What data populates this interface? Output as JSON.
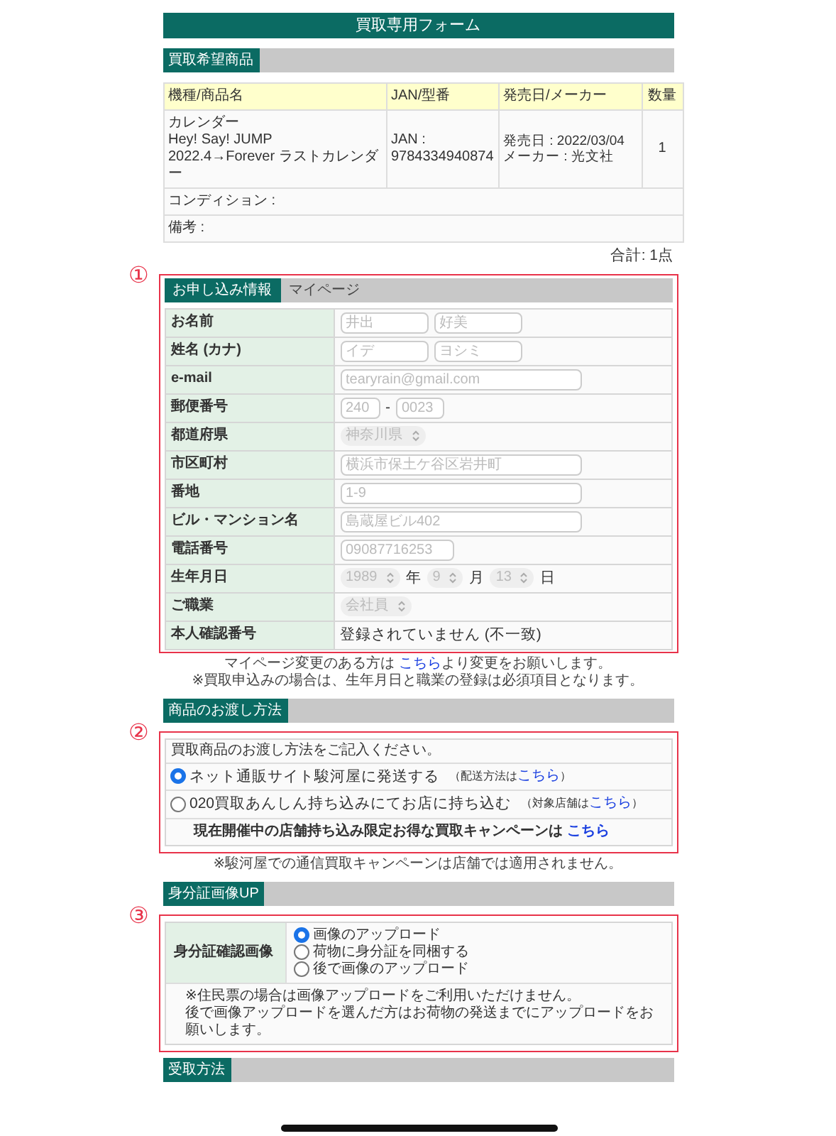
{
  "form_title": "買取専用フォーム",
  "items": {
    "heading": "買取希望商品",
    "columns": [
      "機種/商品名",
      "JAN/型番",
      "発売日/メーカー",
      "数量"
    ],
    "rows": [
      {
        "cells": [
          [
            "カレンダー",
            "Hey! Say! JUMP 2022.4→Forever ラストカレンダー"
          ],
          [
            "JAN : 9784334940874"
          ],
          [
            "発売日 : 2022/03/04",
            "メーカー : 光文社"
          ],
          [
            "1"
          ]
        ]
      }
    ],
    "extra_rows": [
      "コンディション :",
      "備考 :"
    ],
    "total": "合計: 1点"
  },
  "applicant": {
    "annotation": "①",
    "tabs": [
      {
        "label": "お申し込み情報",
        "selected": true
      },
      {
        "label": "マイページ",
        "selected": false
      }
    ],
    "rows": [
      {
        "label": "お名前",
        "parts": [
          {
            "kind": "input",
            "placeholder": "井出"
          },
          {
            "kind": "input",
            "placeholder": "好美"
          }
        ]
      },
      {
        "label": "姓名 (カナ)",
        "parts": [
          {
            "kind": "input",
            "placeholder": "イデ"
          },
          {
            "kind": "input",
            "placeholder": "ヨシミ"
          }
        ]
      },
      {
        "label": "e-mail",
        "parts": [
          {
            "kind": "input",
            "placeholder": "tearyrain@gmail.com"
          }
        ]
      },
      {
        "label": "郵便番号",
        "parts": [
          {
            "kind": "input",
            "placeholder": "240"
          },
          {
            "kind": "text",
            "text": "-"
          },
          {
            "kind": "input",
            "placeholder": "0023"
          }
        ]
      },
      {
        "label": "都道府県",
        "parts": [
          {
            "kind": "select",
            "value": "神奈川県"
          }
        ]
      },
      {
        "label": "市区町村",
        "parts": [
          {
            "kind": "input",
            "placeholder": "横浜市保土ケ谷区岩井町"
          }
        ]
      },
      {
        "label": "番地",
        "parts": [
          {
            "kind": "input",
            "placeholder": "1-9"
          }
        ]
      },
      {
        "label": "ビル・マンション名",
        "parts": [
          {
            "kind": "input",
            "placeholder": "島蔵屋ビル402"
          }
        ]
      },
      {
        "label": "電話番号",
        "parts": [
          {
            "kind": "input",
            "placeholder": "09087716253"
          }
        ]
      },
      {
        "label": "生年月日",
        "parts": [
          {
            "kind": "select",
            "value": "1989"
          },
          {
            "kind": "text",
            "text": "年"
          },
          {
            "kind": "select",
            "value": "9"
          },
          {
            "kind": "text",
            "text": "月"
          },
          {
            "kind": "select",
            "value": "13"
          },
          {
            "kind": "text",
            "text": "日"
          }
        ]
      },
      {
        "label": "ご職業",
        "parts": [
          {
            "kind": "select",
            "value": "会社員"
          }
        ]
      },
      {
        "label": "本人確認番号",
        "parts": [
          {
            "kind": "text",
            "text": "登録されていません (不一致)"
          }
        ]
      }
    ],
    "notes": [
      {
        "before": "マイページ変更のある方は ",
        "link": "こちら",
        "after": "より変更をお願いします。"
      },
      {
        "before": "※買取申込みの場合は、生年月日と職業の登録は必須項目となります。"
      }
    ]
  },
  "delivery": {
    "annotation": "②",
    "heading": "商品のお渡し方法",
    "prompt": "買取商品のお渡し方法をご記入ください。",
    "options": [
      {
        "label": "ネット通販サイト駿河屋に発送する",
        "selected": true,
        "hint_before": "（配送方法は",
        "hint_link": "こちら",
        "hint_after": "）"
      },
      {
        "label": "020買取あんしん持ち込みにてお店に持ち込む",
        "selected": false,
        "hint_before": "（対象店舗は",
        "hint_link": "こちら",
        "hint_after": "）"
      }
    ],
    "campaign": {
      "text": "現在開催中の店舗持ち込み限定お得な買取キャンペーンは ",
      "link": "こちら"
    },
    "note": "※駿河屋での通信買取キャンペーンは店舗では適用されません。"
  },
  "id_upload": {
    "annotation": "③",
    "heading": "身分証画像UP",
    "label": "身分証確認画像",
    "options": [
      {
        "label": "画像のアップロード",
        "selected": true
      },
      {
        "label": "荷物に身分証を同梱する",
        "selected": false
      },
      {
        "label": "後で画像のアップロード",
        "selected": false
      }
    ],
    "notes": [
      "※住民票の場合は画像アップロードをご利用いただけません。",
      "後で画像アップロードを選んだ方はお荷物の発送までにアップロードをお願いします。"
    ]
  },
  "receipt": {
    "heading": "受取方法"
  }
}
